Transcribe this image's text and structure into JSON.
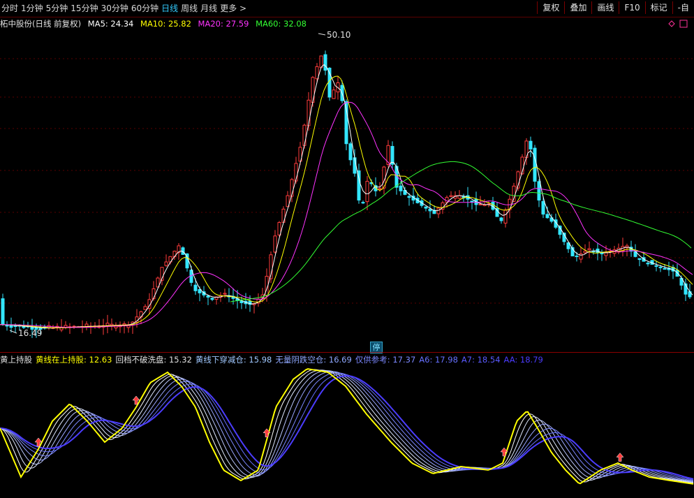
{
  "toolbar": {
    "period_tabs": [
      {
        "label": "分时"
      },
      {
        "label": "1分钟"
      },
      {
        "label": "5分钟"
      },
      {
        "label": "15分钟"
      },
      {
        "label": "30分钟"
      },
      {
        "label": "60分钟"
      },
      {
        "label": "日线",
        "active": true
      },
      {
        "label": "周线"
      },
      {
        "label": "月线"
      }
    ],
    "more_label": "更多 >",
    "right_buttons": [
      {
        "label": "复权"
      },
      {
        "label": "叠加"
      },
      {
        "label": "画线"
      },
      {
        "label": "F10"
      },
      {
        "label": "标记"
      },
      {
        "label": "-自"
      }
    ]
  },
  "main_chart": {
    "title": "柘中股份(日线 前复权)",
    "ma": [
      {
        "label": "MA5: 24.34",
        "color": "#ffffff"
      },
      {
        "label": "MA10: 25.82",
        "color": "#ffff00"
      },
      {
        "label": "MA20: 27.59",
        "color": "#ff33ff"
      },
      {
        "label": "MA60: 32.08",
        "color": "#33ff33"
      }
    ],
    "high_label": "50.10",
    "low_label": "16.49",
    "stop_badge": "停"
  },
  "indicator": {
    "items": [
      {
        "label": "黄上持股",
        "color": "#e0e0e0"
      },
      {
        "label": "黄线在上持股: 12.63",
        "color": "#ffff00"
      },
      {
        "label": "回档不破洗盘: 15.32",
        "color": "#e0e0e0"
      },
      {
        "label": "黄线下穿减仓: 15.98",
        "color": "#a0c8ff"
      },
      {
        "label": "无量阴跌空仓: 16.69",
        "color": "#8fa8ff"
      },
      {
        "label": "仅供参考: 17.37",
        "color": "#7c88ff"
      },
      {
        "label": "A6: 17.98",
        "color": "#6670ff"
      },
      {
        "label": "A7: 18.54",
        "color": "#5a5aff"
      },
      {
        "label": "AA: 18.79",
        "color": "#4b3cff"
      }
    ]
  },
  "colors": {
    "up": "#ff3b3b",
    "down": "#33e6ff",
    "grid": "#7a0000"
  },
  "chart_data": [
    {
      "type": "candlestick",
      "title": "柘中股份(日线 前复权)",
      "y_annotations": {
        "high": 50.1,
        "low": 16.49
      },
      "series": [
        {
          "name": "MA5",
          "last": 24.34
        },
        {
          "name": "MA10",
          "last": 25.82
        },
        {
          "name": "MA20",
          "last": 27.59
        },
        {
          "name": "MA60",
          "last": 32.08
        }
      ]
    },
    {
      "type": "line",
      "series": [
        {
          "name": "黄线在上持股",
          "last": 12.63
        },
        {
          "name": "回档不破洗盘",
          "last": 15.32
        },
        {
          "name": "黄线下穿减仓",
          "last": 15.98
        },
        {
          "name": "无量阴跌空仓",
          "last": 16.69
        },
        {
          "name": "仅供参考",
          "last": 17.37
        },
        {
          "name": "A6",
          "last": 17.98
        },
        {
          "name": "A7",
          "last": 18.54
        },
        {
          "name": "AA",
          "last": 18.79
        }
      ]
    }
  ]
}
